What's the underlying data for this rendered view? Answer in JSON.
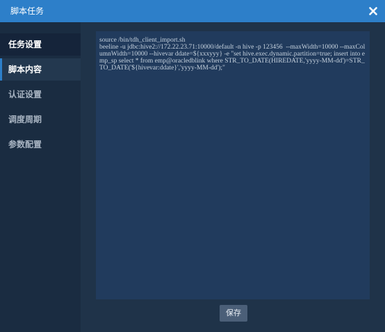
{
  "dialog": {
    "title": "脚本任务",
    "close_icon": "close-icon"
  },
  "sidebar": {
    "items": [
      {
        "label": "任务设置"
      },
      {
        "label": "脚本内容"
      },
      {
        "label": "认证设置"
      },
      {
        "label": "调度周期"
      },
      {
        "label": "参数配置"
      }
    ]
  },
  "editor": {
    "script": "source /bin/tdh_client_import.sh\nbeeline -u jdbc:hive2://172.22.23.71:10000/default -n hive -p 123456  --maxWidth=10000 --maxColumnWidth=10000 --hivevar ddate=${xxxyyy} -e \"set hive.exec.dynamic.partition=true; insert into emp_sp select * from emp@oracledblink where STR_TO_DATE(HIREDATE,'yyyy-MM-dd')=STR_TO_DATE('${hivevar:ddate}','yyyy-MM-dd');\""
  },
  "footer": {
    "save_label": "保存"
  },
  "colors": {
    "titlebar": "#2d7fc9",
    "background": "#1e3147",
    "editor": "#213b5d"
  }
}
